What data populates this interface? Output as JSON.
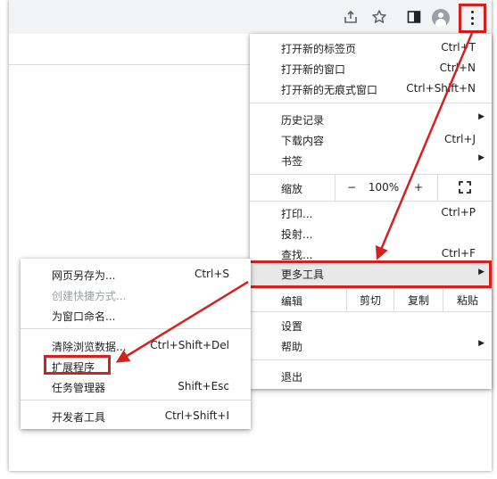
{
  "menu": {
    "new_tab": {
      "label": "打开新的标签页",
      "shortcut": "Ctrl+T"
    },
    "new_window": {
      "label": "打开新的窗口",
      "shortcut": "Ctrl+N"
    },
    "new_incognito": {
      "label": "打开新的无痕式窗口",
      "shortcut": "Ctrl+Shift+N"
    },
    "history": {
      "label": "历史记录"
    },
    "downloads": {
      "label": "下载内容",
      "shortcut": "Ctrl+J"
    },
    "bookmarks": {
      "label": "书签"
    },
    "zoom": {
      "label": "缩放",
      "minus": "−",
      "value": "100%",
      "plus": "+"
    },
    "print": {
      "label": "打印...",
      "shortcut": "Ctrl+P"
    },
    "cast": {
      "label": "投射..."
    },
    "find": {
      "label": "查找...",
      "shortcut": "Ctrl+F"
    },
    "more_tools": {
      "label": "更多工具"
    },
    "edit": {
      "label": "编辑",
      "cut": "剪切",
      "copy": "复制",
      "paste": "粘贴"
    },
    "settings": {
      "label": "设置"
    },
    "help": {
      "label": "帮助"
    },
    "exit": {
      "label": "退出"
    }
  },
  "submenu": {
    "save_page": {
      "label": "网页另存为...",
      "shortcut": "Ctrl+S"
    },
    "create_shortcut": {
      "label": "创建快捷方式..."
    },
    "name_window": {
      "label": "为窗口命名..."
    },
    "clear_data": {
      "label": "清除浏览数据...",
      "shortcut": "Ctrl+Shift+Del"
    },
    "extensions": {
      "label": "扩展程序"
    },
    "task_manager": {
      "label": "任务管理器",
      "shortcut": "Shift+Esc"
    },
    "dev_tools": {
      "label": "开发者工具",
      "shortcut": "Ctrl+Shift+I"
    }
  },
  "colors": {
    "annotation_red": "#d32121",
    "menu_hover": "#e8e8e8",
    "toolbar_bg": "#f1f3f4"
  },
  "icons": [
    "share-icon",
    "star-icon",
    "side-panel-icon",
    "profile-icon",
    "kebab-menu-icon",
    "chevron-right-icon",
    "fullscreen-icon"
  ]
}
